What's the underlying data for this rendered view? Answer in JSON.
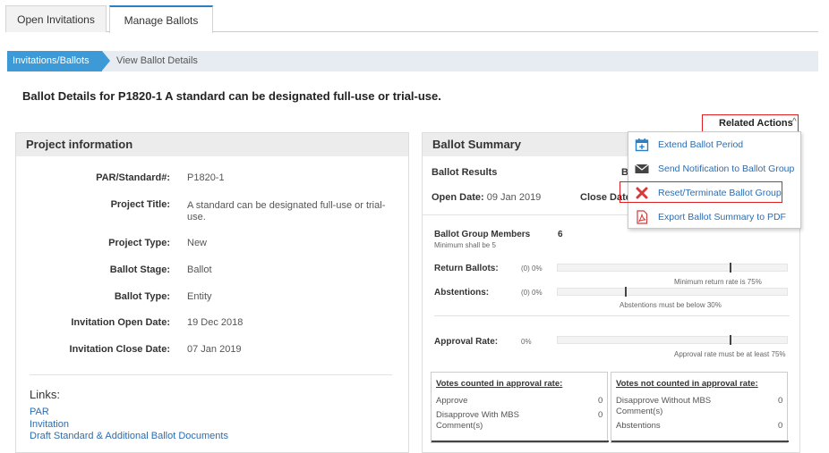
{
  "tabs": [
    {
      "label": "Open Invitations"
    },
    {
      "label": "Manage Ballots"
    }
  ],
  "breadcrumb": [
    {
      "label": "Invitations/Ballots"
    },
    {
      "label": "View Ballot Details"
    }
  ],
  "page_title": "Ballot Details for P1820-1 A standard can be designated full-use or trial-use.",
  "related_actions": {
    "label": "Related Actions",
    "items": [
      {
        "label": "Extend Ballot Period",
        "icon": "calendar-plus-icon"
      },
      {
        "label": "Send Notification to Ballot Group",
        "icon": "envelope-icon"
      },
      {
        "label": "Reset/Terminate Ballot Group",
        "icon": "x-icon"
      },
      {
        "label": "Export Ballot Summary to PDF",
        "icon": "pdf-icon"
      }
    ]
  },
  "project_info": {
    "title": "Project information",
    "rows": [
      {
        "label": "PAR/Standard#:",
        "value": "P1820-1"
      },
      {
        "label": "Project Title:",
        "value": "A standard can be designated full-use or trial-use."
      },
      {
        "label": "Project Type:",
        "value": "New"
      },
      {
        "label": "Ballot Stage:",
        "value": "Ballot"
      },
      {
        "label": "Ballot Type:",
        "value": "Entity"
      },
      {
        "label": "Invitation Open Date:",
        "value": "19 Dec 2018"
      },
      {
        "label": "Invitation Close Date:",
        "value": "07 Jan 2019"
      }
    ],
    "links_title": "Links:",
    "links": [
      "PAR",
      "Invitation",
      "Draft Standard & Additional Ballot Documents"
    ]
  },
  "ballot_summary": {
    "title": "Ballot Summary",
    "results_label": "Ballot Results",
    "results_right_fragment": "B",
    "open_date_label": "Open Date:",
    "open_date": "09 Jan 2019",
    "close_date_label": "Close Date:",
    "group_members_label": "Ballot Group Members",
    "group_members_value": "6",
    "group_members_note": "Minimum shall be 5",
    "return_label": "Return Ballots:",
    "return_value": "(0) 0%",
    "return_fill": 0,
    "return_note": "Minimum return rate is 75%",
    "abstain_label": "Abstentions:",
    "abstain_value": "(0) 0%",
    "abstain_fill": 0,
    "abstain_note": "Abstentions must be below 30%",
    "approval_label": "Approval Rate:",
    "approval_value": "0%",
    "approval_fill": 0,
    "approval_note": "Approval rate must be at least 75%",
    "votes_counted": {
      "title": "Votes counted in approval rate:",
      "rows": [
        {
          "label": "Approve",
          "value": "0"
        },
        {
          "label": "Disapprove With MBS Comment(s)",
          "value": "0"
        }
      ]
    },
    "votes_not_counted": {
      "title": "Votes not counted in approval rate:",
      "rows": [
        {
          "label": "Disapprove Without MBS Comment(s)",
          "value": "0"
        },
        {
          "label": "Abstentions",
          "value": "0"
        }
      ]
    }
  },
  "colors": {
    "accent": "#3d9ad6",
    "link": "#2a6db3",
    "highlight": "#e02020"
  }
}
